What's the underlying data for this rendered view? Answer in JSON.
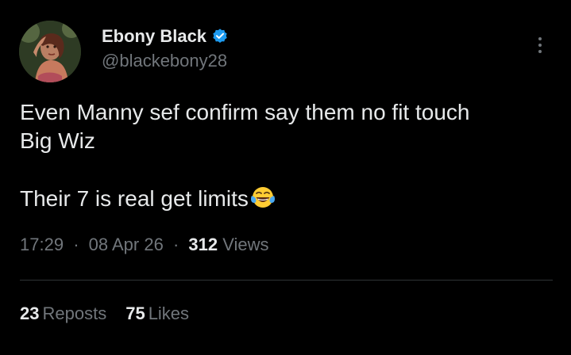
{
  "author": {
    "name": "Ebony Black",
    "handle": "@blackebony28",
    "verified": true,
    "verified_color": "#1d9bf0"
  },
  "tweet": {
    "line1": "Even Manny sef confirm say them no fit touch",
    "line2": "Big Wiz",
    "line3": "Their 7 is real get limits",
    "emoji": "face-with-tears-of-joy"
  },
  "meta": {
    "time": "17:29",
    "separator": "·",
    "date": "08 Apr 26",
    "views_count": "312",
    "views_label": "Views"
  },
  "stats": {
    "reposts_count": "23",
    "reposts_label": "Reposts",
    "likes_count": "75",
    "likes_label": "Likes"
  },
  "colors": {
    "background": "#000000",
    "text_primary": "#e7e9ea",
    "text_secondary": "#71767b",
    "divider": "#2f3336"
  }
}
